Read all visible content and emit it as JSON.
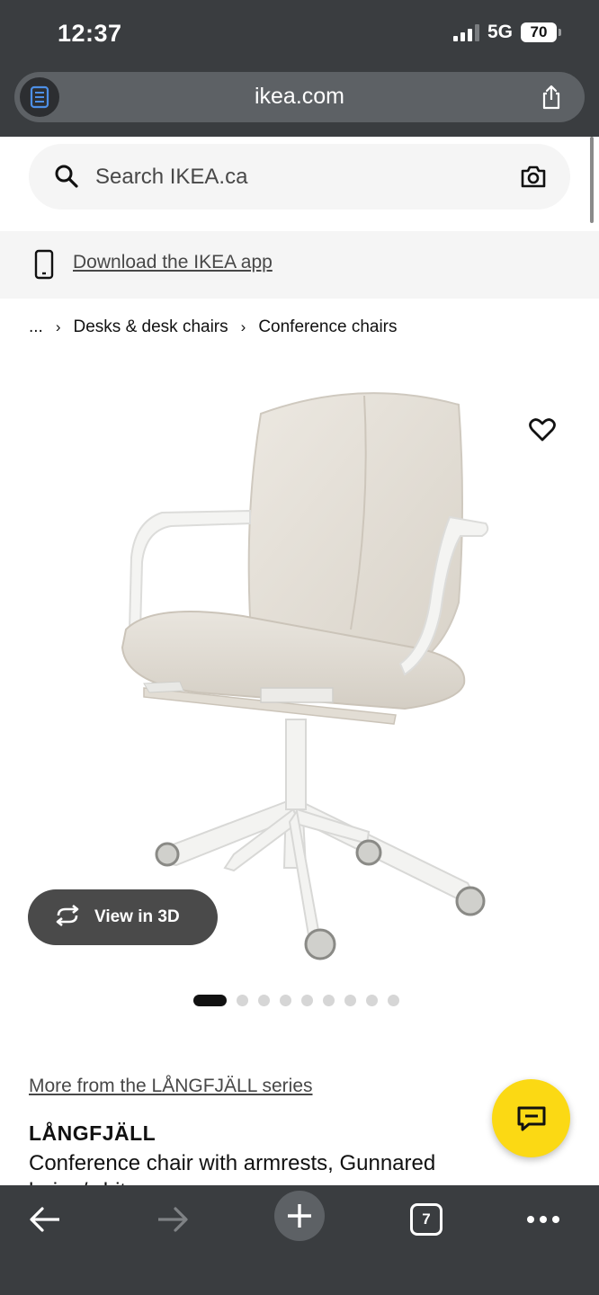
{
  "status_bar": {
    "time": "12:37",
    "network": "5G",
    "battery": "70"
  },
  "browser": {
    "url": "ikea.com",
    "tab_count": "7"
  },
  "search": {
    "placeholder": "Search IKEA.ca"
  },
  "app_banner": {
    "link_text": "Download the IKEA app"
  },
  "breadcrumb": {
    "items": [
      "...",
      "Desks & desk chairs",
      "Conference chairs"
    ]
  },
  "gallery": {
    "view_3d_label": "View in 3D",
    "image_count": 10,
    "active_index": 0
  },
  "product": {
    "series_link": "More from the LÅNGFJÄLL series",
    "name": "LÅNGFJÄLL",
    "description": "Conference chair with armrests, Gunnared beige/white"
  },
  "colors": {
    "chrome": "#3a3d40",
    "chat_fab": "#fbd914"
  },
  "icons": {
    "reader": "reader-icon",
    "share": "share-icon",
    "search": "search-icon",
    "camera": "camera-icon",
    "phone": "phone-icon",
    "favorite": "heart-icon",
    "rotate_3d": "rotate-icon",
    "chat": "chat-icon",
    "back": "back-arrow-icon",
    "forward": "forward-arrow-icon",
    "new_tab": "plus-icon",
    "more": "more-icon"
  }
}
